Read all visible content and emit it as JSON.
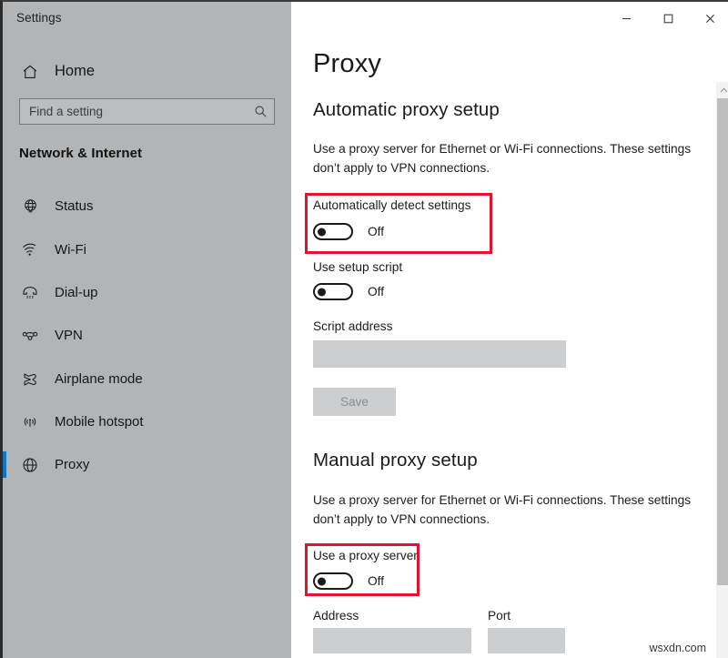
{
  "window": {
    "app_title": "Settings",
    "controls": [
      {
        "name": "minimize",
        "glyph": "─"
      },
      {
        "name": "maximize",
        "glyph": "□"
      },
      {
        "name": "close",
        "glyph": "✕"
      }
    ]
  },
  "sidebar": {
    "home_label": "Home",
    "search": {
      "placeholder": "Find a setting",
      "value": ""
    },
    "category": "Network & Internet",
    "items": [
      {
        "label": "Status",
        "icon": "globe-status-icon",
        "selected": false
      },
      {
        "label": "Wi-Fi",
        "icon": "wifi-icon",
        "selected": false
      },
      {
        "label": "Dial-up",
        "icon": "phone-handset-icon",
        "selected": false
      },
      {
        "label": "VPN",
        "icon": "vpn-icon",
        "selected": false
      },
      {
        "label": "Airplane mode",
        "icon": "airplane-icon",
        "selected": false
      },
      {
        "label": "Mobile hotspot",
        "icon": "broadcast-icon",
        "selected": false
      },
      {
        "label": "Proxy",
        "icon": "globe-icon",
        "selected": true
      }
    ]
  },
  "main": {
    "page_title": "Proxy",
    "automatic_section": {
      "heading": "Automatic proxy setup",
      "description": "Use a proxy server for Ethernet or Wi-Fi connections. These settings don’t apply to VPN connections.",
      "auto_detect": {
        "label": "Automatically detect settings",
        "state": "Off",
        "highlighted": true
      },
      "use_setup_script": {
        "label": "Use setup script",
        "state": "Off",
        "highlighted": false
      },
      "script_address": {
        "label": "Script address",
        "value": "",
        "placeholder": ""
      },
      "save_label": "Save",
      "save_disabled": true
    },
    "manual_section": {
      "heading": "Manual proxy setup",
      "description": "Use a proxy server for Ethernet or Wi-Fi connections. These settings don’t apply to VPN connections.",
      "use_proxy_server": {
        "label": "Use a proxy server",
        "state": "Off",
        "highlighted": true
      },
      "address": {
        "label": "Address",
        "value": "",
        "placeholder": ""
      },
      "port": {
        "label": "Port",
        "value": "",
        "placeholder": ""
      }
    }
  },
  "colors": {
    "accent": "#0078d7",
    "highlight": "#e8112d",
    "sidebar_bg": "#b2b4b6",
    "input_bg": "#cccecf"
  },
  "watermark": "wsxdn.com"
}
